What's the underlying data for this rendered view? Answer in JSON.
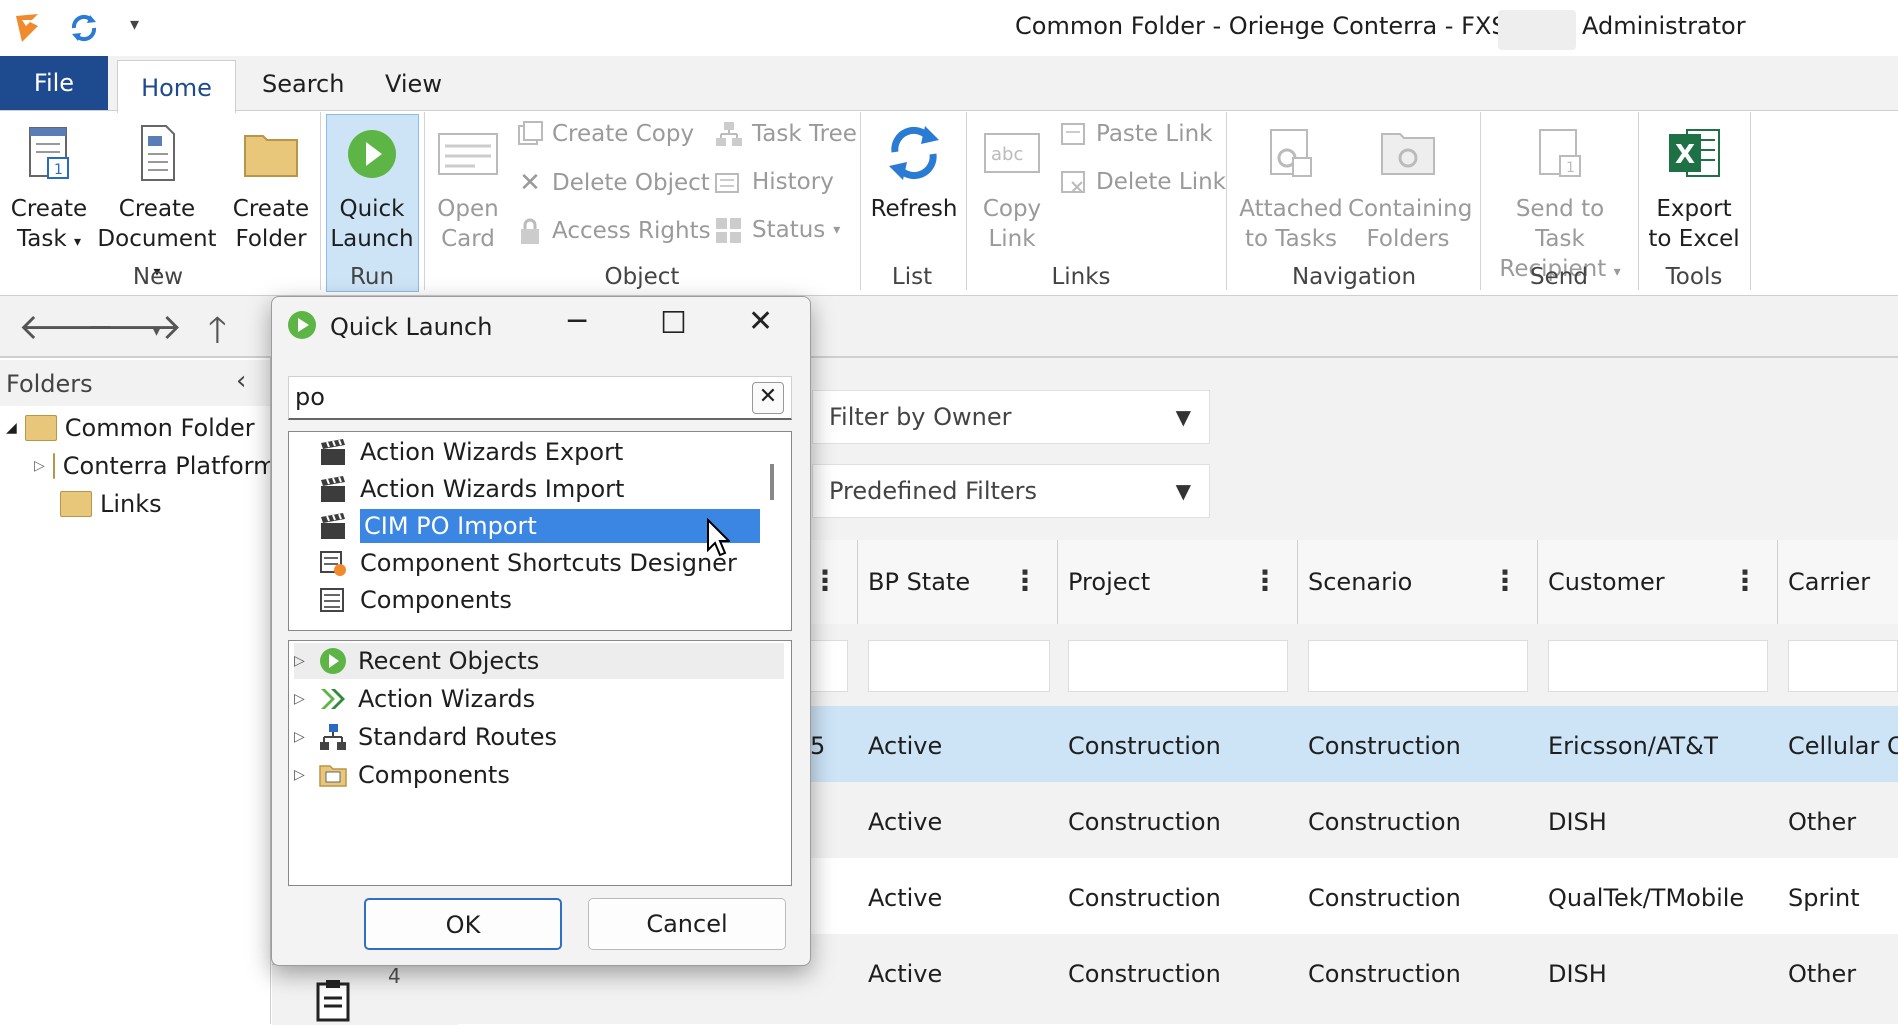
{
  "window": {
    "title": "Common Folder - Oriенge Conterra - FXSRV -",
    "user": "Administrator"
  },
  "tabs": {
    "file": "File",
    "home": "Home",
    "search": "Search",
    "view": "View"
  },
  "ribbon": {
    "create_task": [
      "Create",
      "Task"
    ],
    "create_document": [
      "Create",
      "Document"
    ],
    "create_folder": [
      "Create",
      "Folder"
    ],
    "quick_launch": [
      "Quick",
      "Launch"
    ],
    "open_card": [
      "Open",
      "Card"
    ],
    "create_copy": "Create Copy",
    "delete_object": "Delete Object",
    "access_rights": "Access Rights",
    "task_tree": "Task Tree",
    "history": "History",
    "status": "Status",
    "refresh": "Refresh",
    "copy_link": [
      "Copy",
      "Link"
    ],
    "paste_link": "Paste Link",
    "delete_link": "Delete Link",
    "attached_to_tasks": [
      "Attached",
      "to Tasks"
    ],
    "containing_folders": [
      "Containing",
      "Folders"
    ],
    "send_to_task_recipient": [
      "Send to Task",
      "Recipient"
    ],
    "export_to_excel": [
      "Export",
      "to Excel"
    ],
    "groups": {
      "new": "New",
      "run": "Run",
      "object": "Object",
      "list": "List",
      "links": "Links",
      "navigation": "Navigation",
      "send": "Send",
      "tools": "Tools"
    }
  },
  "folders": {
    "title": "Folders",
    "items": [
      "Common Folder",
      "Conterra Platform",
      "Links"
    ]
  },
  "filters": {
    "owner": "Filter by Owner",
    "predefined": "Predefined Filters"
  },
  "grid": {
    "columns": [
      "BP State",
      "Project",
      "Scenario",
      "Customer",
      "Carrier"
    ],
    "rows": [
      [
        "Active",
        "Construction",
        "Construction",
        "Ericsson/AT&T",
        "Cellular One"
      ],
      [
        "Active",
        "Construction",
        "Construction",
        "DISH",
        "Other"
      ],
      [
        "Active",
        "Construction",
        "Construction",
        "QualTek/TMobile",
        "Sprint"
      ],
      [
        "Active",
        "Construction",
        "Construction",
        "DISH",
        "Other"
      ]
    ],
    "partial_row_numbers": [
      "5",
      "4"
    ]
  },
  "dialog": {
    "title": "Quick Launch",
    "search_value": "po",
    "results": [
      "Action Wizards Export",
      "Action Wizards Import",
      "CIM PO Import",
      "Component Shortcuts Designer",
      "Components"
    ],
    "selected_index": 2,
    "tree": [
      "Recent Objects",
      "Action Wizards",
      "Standard Routes",
      "Components"
    ],
    "ok": "OK",
    "cancel": "Cancel"
  },
  "colors": {
    "accent": "#1e4b8f",
    "selection": "#3a86e2",
    "row_highlight": "#cde4f7"
  }
}
